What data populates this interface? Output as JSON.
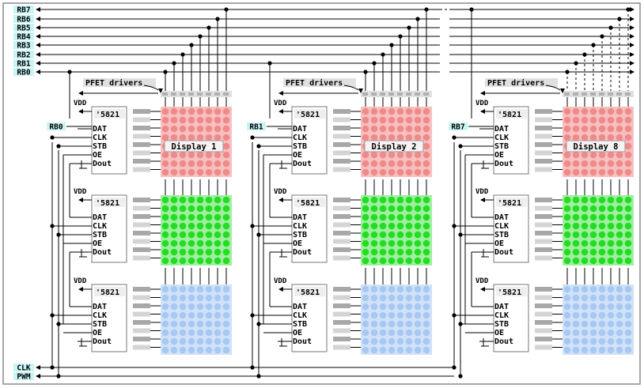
{
  "left_port_labels": [
    "RB7",
    "RB6",
    "RB5",
    "RB4",
    "RB3",
    "RB2",
    "RB1",
    "RB0"
  ],
  "bottom_labels": [
    "CLK",
    "PWM"
  ],
  "pfet_label": "PFET drivers",
  "chip": {
    "name": "'5821",
    "vdd": "VDD",
    "pins": [
      "DAT",
      "CLK",
      "STB",
      "OE",
      "Dout"
    ]
  },
  "columns": [
    {
      "rb_label": "RB0",
      "display_label": "Display 1"
    },
    {
      "rb_label": "RB1",
      "display_label": "Display 2"
    },
    {
      "rb_label": "RB7",
      "display_label": "Display 8"
    }
  ],
  "colors": {
    "border": "#8a8a8a",
    "label_bg": "#c8f4f4",
    "pfet_bg": "#e0e0e0",
    "led_red": "#f08a8a",
    "led_red_bg": "#f6c0c0",
    "led_green": "#22dd22",
    "led_green_bg": "#a0eea0",
    "led_blue": "#a8c8f4",
    "led_blue_bg": "#d0e2f8",
    "bar_dark": "#a8a8a8",
    "bar_light": "#d4d4d4"
  }
}
